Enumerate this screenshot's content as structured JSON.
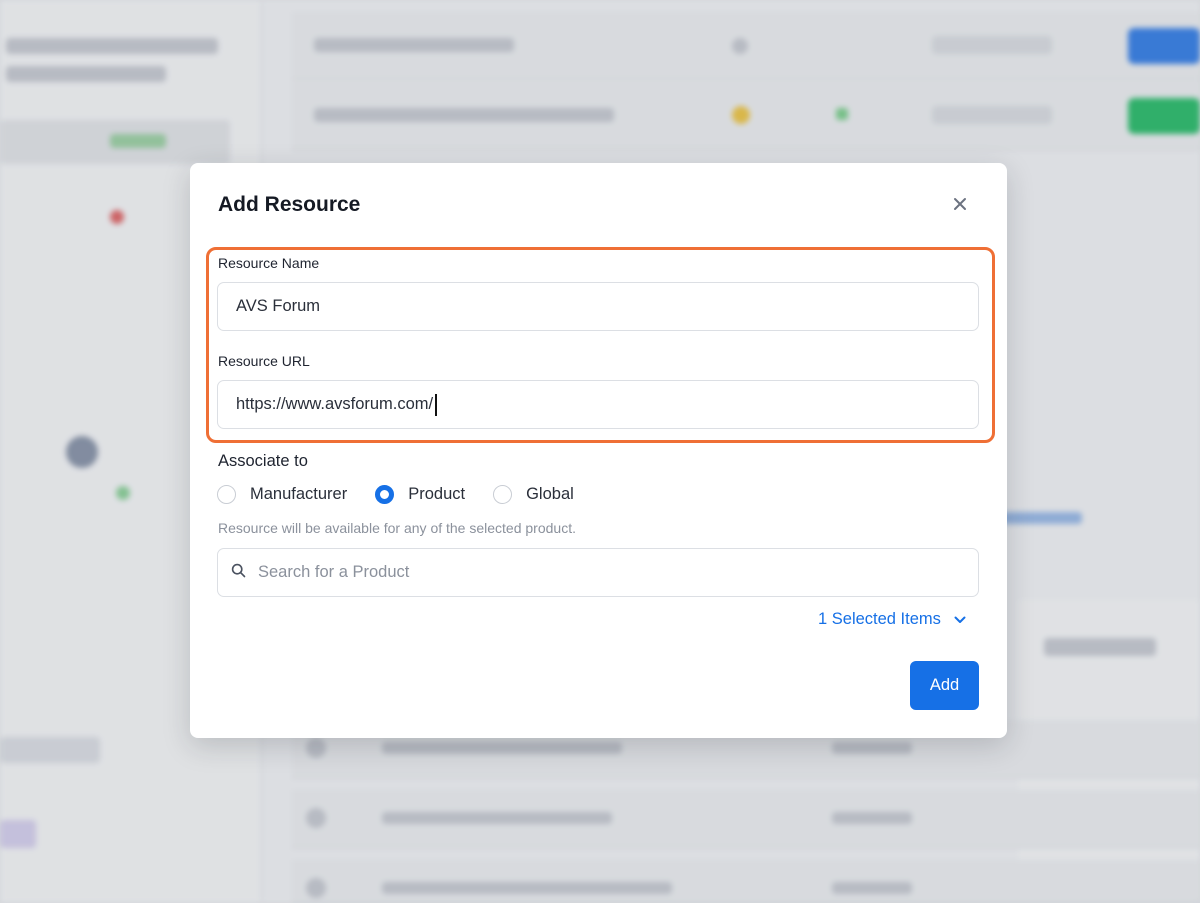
{
  "modal": {
    "title": "Add Resource",
    "resource_name": {
      "label": "Resource Name",
      "value": "AVS Forum"
    },
    "resource_url": {
      "label": "Resource URL",
      "value": "https://www.avsforum.com/"
    },
    "associate": {
      "label": "Associate to",
      "options": [
        {
          "label": "Manufacturer",
          "checked": false
        },
        {
          "label": "Product",
          "checked": true
        },
        {
          "label": "Global",
          "checked": false
        }
      ],
      "helper": "Resource will be available for any of the selected product."
    },
    "search": {
      "placeholder": "Search for a Product",
      "icon": "search-icon"
    },
    "selected_items": "1 Selected Items",
    "add_label": "Add"
  },
  "colors": {
    "accent": "#1670e6",
    "highlight": "#ef6f35"
  }
}
